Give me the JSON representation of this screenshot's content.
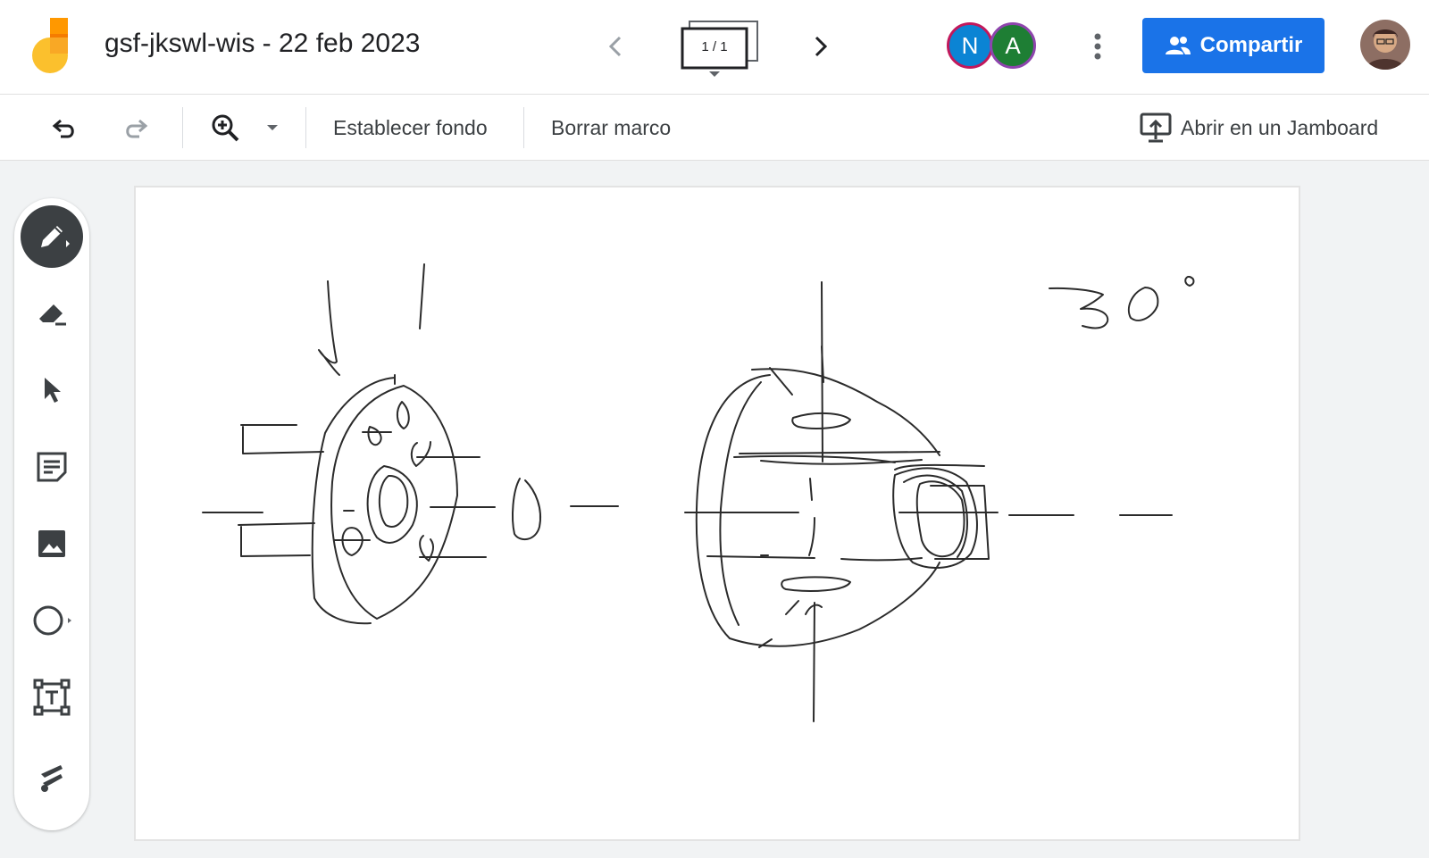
{
  "header": {
    "title": "gsf-jkswl-wis - 22 feb 2023",
    "frame_indicator": "1 / 1",
    "collaborators": [
      {
        "initial": "N",
        "color": "#0b84d4"
      },
      {
        "initial": "A",
        "color": "#1e7e34"
      }
    ],
    "share_label": "Compartir"
  },
  "toolbar": {
    "set_background": "Establecer fondo",
    "clear_frame": "Borrar marco",
    "open_in_jamboard": "Abrir en un Jamboard"
  },
  "tools": [
    {
      "name": "pen-tool",
      "icon": "pen-icon",
      "active": true
    },
    {
      "name": "eraser-tool",
      "icon": "eraser-icon",
      "active": false
    },
    {
      "name": "select-tool",
      "icon": "cursor-icon",
      "active": false
    },
    {
      "name": "sticky-note-tool",
      "icon": "sticky-note-icon",
      "active": false
    },
    {
      "name": "image-tool",
      "icon": "image-icon",
      "active": false
    },
    {
      "name": "circle-tool",
      "icon": "circle-icon",
      "active": false
    },
    {
      "name": "text-box-tool",
      "icon": "text-box-icon",
      "active": false
    },
    {
      "name": "laser-tool",
      "icon": "laser-icon",
      "active": false
    }
  ],
  "colors": {
    "accent": "#1a73e8",
    "toolbar_bg": "#ffffff",
    "app_bg": "#f1f3f4",
    "active_tool": "#3c4043"
  }
}
